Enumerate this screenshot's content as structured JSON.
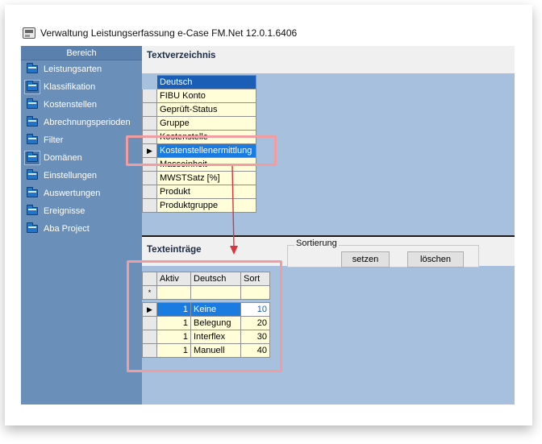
{
  "window": {
    "title": "Verwaltung Leistungserfassung e-Case FM.Net 12.0.1.6406",
    "icon": "app-icon"
  },
  "sidebar": {
    "header": "Bereich",
    "items": [
      {
        "label": "Leistungsarten",
        "icon": "folder-icon",
        "selected": false
      },
      {
        "label": "Klassifikation",
        "icon": "folder-icon",
        "selected": true
      },
      {
        "label": "Kostenstellen",
        "icon": "folder-icon",
        "selected": false
      },
      {
        "label": "Abrechnungsperioden",
        "icon": "folder-icon",
        "selected": false
      },
      {
        "label": "Filter",
        "icon": "folder-icon",
        "selected": false
      },
      {
        "label": "Domänen",
        "icon": "folder-icon",
        "selected": true
      },
      {
        "label": "Einstellungen",
        "icon": "folder-icon",
        "selected": false
      },
      {
        "label": "Auswertungen",
        "icon": "folder-icon",
        "selected": false
      },
      {
        "label": "Ereignisse",
        "icon": "folder-icon",
        "selected": false
      },
      {
        "label": "Aba Project",
        "icon": "folder-icon",
        "selected": false
      }
    ]
  },
  "textverzeichnis": {
    "title": "Textverzeichnis",
    "column": "Deutsch",
    "rows": [
      "FIBU Konto",
      "Geprüft-Status",
      "Gruppe",
      "Kostenstelle",
      "Kostenstellenermittlung",
      "Masseinheit",
      "MWSTSatz [%]",
      "Produkt",
      "Produktgruppe"
    ],
    "selected_row": "Kostenstellenermittlung"
  },
  "texteintraege": {
    "title": "Texteinträge",
    "columns": [
      "Aktiv",
      "Deutsch",
      "Sort"
    ],
    "new_row_marker": "*",
    "rows": [
      {
        "aktiv": "1",
        "deutsch": "Keine",
        "sort": "10"
      },
      {
        "aktiv": "1",
        "deutsch": "Belegung",
        "sort": "20"
      },
      {
        "aktiv": "1",
        "deutsch": "Interflex",
        "sort": "30"
      },
      {
        "aktiv": "1",
        "deutsch": "Manuell",
        "sort": "40"
      }
    ]
  },
  "sortierung": {
    "label": "Sortierung",
    "set_button": "setzen",
    "delete_button": "löschen"
  },
  "colors": {
    "sidebar": "#6a8fb9",
    "panel": "#a7c0de",
    "grid_cell": "#fffed9",
    "selection": "#1a7be0",
    "highlight": "#f09ca1"
  }
}
